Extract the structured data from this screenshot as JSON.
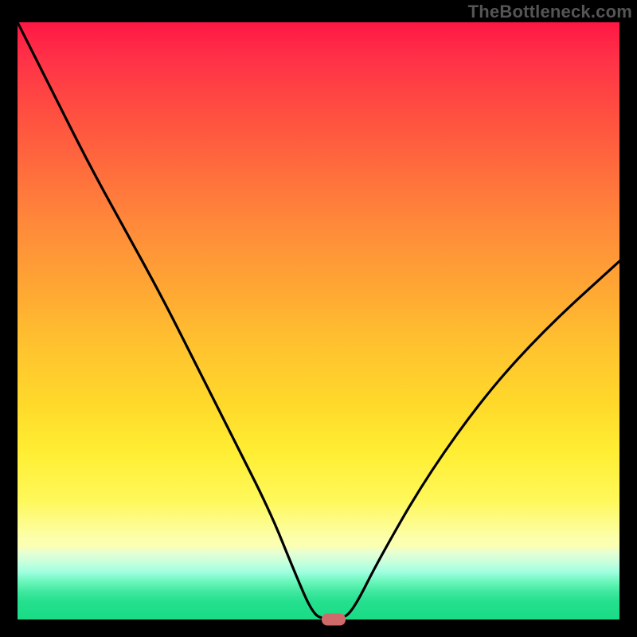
{
  "watermark": "TheBottleneck.com",
  "colors": {
    "frame": "#000000",
    "watermark": "#555555",
    "curve": "#000000",
    "marker": "#cf6a6a"
  },
  "chart_data": {
    "type": "line",
    "title": "",
    "xlabel": "",
    "ylabel": "",
    "xlim": [
      0,
      100
    ],
    "ylim": [
      0,
      100
    ],
    "grid": false,
    "legend": false,
    "series": [
      {
        "name": "bottleneck-curve",
        "x": [
          0,
          6,
          12,
          18,
          24,
          30,
          36,
          42,
          46,
          49,
          51,
          54,
          56,
          60,
          68,
          78,
          88,
          100
        ],
        "values": [
          100,
          88,
          76,
          65,
          54,
          42,
          30,
          18,
          8,
          1,
          0,
          0,
          2,
          10,
          24,
          38,
          49,
          60
        ]
      }
    ],
    "annotations": [
      {
        "name": "optimal-marker",
        "x": 52.5,
        "y": 0
      }
    ],
    "gradient_stops": [
      {
        "pos": 0,
        "color": "#ff1744"
      },
      {
        "pos": 34,
        "color": "#ff8a3a"
      },
      {
        "pos": 64,
        "color": "#ffd92a"
      },
      {
        "pos": 87,
        "color": "#fcffb0"
      },
      {
        "pos": 100,
        "color": "#1adb86"
      }
    ]
  }
}
